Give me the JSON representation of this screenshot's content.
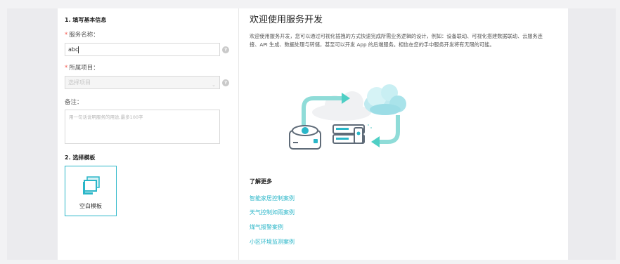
{
  "form": {
    "section1_title": "1. 填写基本信息",
    "service_name_label": "服务名称：",
    "service_name_value": "abc",
    "project_label": "所属项目：",
    "project_placeholder": "选择项目",
    "remark_label": "备注：",
    "remark_placeholder": "用一句话说明服务的用途,最多100字",
    "help_glyph": "?",
    "required_mark": "*",
    "section2_title": "2. 选择模板",
    "templates": [
      {
        "label": "空白模板",
        "icon": "blank-template-icon",
        "selected": true
      }
    ]
  },
  "welcome": {
    "title": "欢迎使用服务开发",
    "description": "欢迎使用服务开发，您可以通过可视化插拽的方式快速完成所需业务逻辑的设计，例如：设备联动、可视化搭建数据联动、云服务连接、API 生成、数据处理与转储，甚至可以开发 App 的后端服务。相信在您的手中服务开发将有无限的可能。",
    "illustration": "cloud-device-sync-illustration"
  },
  "learn_more": {
    "title": "了解更多",
    "links": [
      "智能家居控制案例",
      "天气控制如雨案例",
      "煤气报警案例",
      "小区环境监测案例"
    ]
  },
  "colors": {
    "accent": "#2ab6c8",
    "required": "#f5554a",
    "page_bg": "#f2f2f4"
  }
}
